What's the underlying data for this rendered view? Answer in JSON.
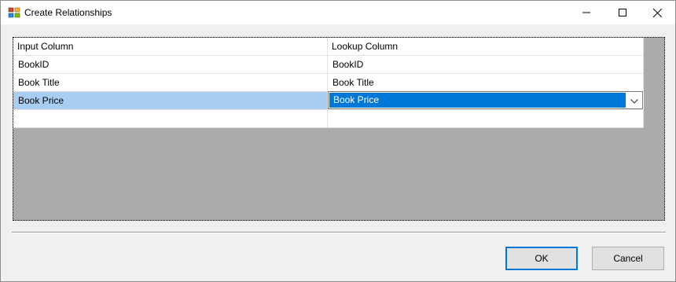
{
  "window": {
    "title": "Create Relationships",
    "icon": "app-window-icon",
    "controls": [
      "minimize-icon",
      "maximize-icon",
      "close-icon"
    ]
  },
  "grid": {
    "columns": [
      "Input Column",
      "Lookup Column"
    ],
    "rows": [
      {
        "input": "BookID",
        "lookup": "BookID"
      },
      {
        "input": "Book Title",
        "lookup": "Book Title"
      },
      {
        "input": "Book Price",
        "lookup": "Book Price",
        "selected": true,
        "editing": true
      },
      {
        "input": "",
        "lookup": ""
      }
    ]
  },
  "buttons": {
    "ok": "OK",
    "cancel": "Cancel"
  },
  "colors": {
    "selection_row": "#a9cdf0",
    "dropdown_highlight": "#0078d7",
    "default_button_border": "#0078d7"
  }
}
